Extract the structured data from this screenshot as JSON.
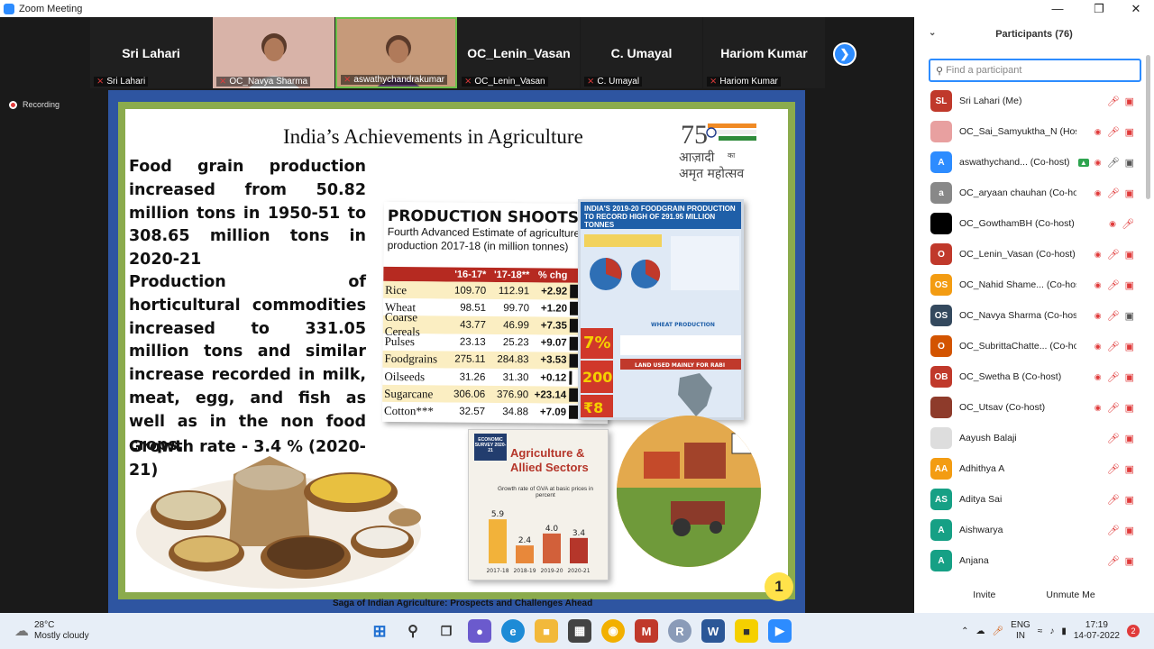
{
  "window": {
    "title": "Zoom Meeting"
  },
  "thumbnails": [
    {
      "big_name": "Sri Lahari",
      "small_name": "Sri Lahari",
      "video": false
    },
    {
      "big_name": "",
      "small_name": "OC_Navya Sharma",
      "video": true
    },
    {
      "big_name": "",
      "small_name": "aswathychandrakumar",
      "video": true,
      "active": true
    },
    {
      "big_name": "OC_Lenin_Vasan",
      "small_name": "OC_Lenin_Vasan",
      "video": false
    },
    {
      "big_name": "C. Umayal",
      "small_name": "C. Umayal",
      "video": false
    },
    {
      "big_name": "Hariom Kumar",
      "small_name": "Hariom Kumar",
      "video": false
    }
  ],
  "recording_label": "Recording",
  "slide": {
    "title": "India’s Achievements in Agriculture",
    "para1": "Food grain production increased from 50.82 million tons in 1950-51 to 308.65 million tons in 2020-21",
    "para2": "Production of horticultural commodities increased to 331.05 million tons and similar increase recorded in milk, meat, egg, and fish as well as in the non food crops.",
    "para3": "Growth rate - 3.4 % (2020-21)",
    "footer": "Saga of Indian Agriculture: Prospects and Challenges Ahead",
    "page_number": "1",
    "logo_text_1": "आज़ादी",
    "logo_text_small": "का",
    "logo_text_2": "अमृत महोत्सव",
    "logo_num": "75",
    "table": {
      "heading": "PRODUCTION SHOOTS UP",
      "subheading": "Fourth Advanced Estimate of agriculture production 2017-18 (in million tonnes)",
      "columns": [
        "",
        "'16-17*",
        "'17-18**",
        "% chg"
      ],
      "rows": [
        {
          "crop": "Rice",
          "a": "109.70",
          "b": "112.91",
          "chg": "+2.92",
          "bar": 0.9
        },
        {
          "crop": "Wheat",
          "a": "98.51",
          "b": "99.70",
          "chg": "+1.20",
          "bar": 0.55
        },
        {
          "crop": "Coarse Cereals",
          "a": "43.77",
          "b": "46.99",
          "chg": "+7.35",
          "bar": 1.0
        },
        {
          "crop": "Pulses",
          "a": "23.13",
          "b": "25.23",
          "chg": "+9.07",
          "bar": 1.0
        },
        {
          "crop": "Foodgrains",
          "a": "275.11",
          "b": "284.83",
          "chg": "+3.53",
          "bar": 0.95
        },
        {
          "crop": "Oilseeds",
          "a": "31.26",
          "b": "31.30",
          "chg": "+0.12",
          "bar": 0.1
        },
        {
          "crop": "Sugarcane",
          "a": "306.06",
          "b": "376.90",
          "chg": "+23.14",
          "bar": 1.0
        },
        {
          "crop": "Cotton***",
          "a": "32.57",
          "b": "34.88",
          "chg": "+7.09",
          "bar": 1.0
        }
      ]
    },
    "info_right_header": "INDIA'S 2019-20 FOODGRAIN PRODUCTION TO RECORD HIGH OF 291.95 MILLION TONNES",
    "info_right_sub": "WHEAT PRODUCTION",
    "info_right_sub2": "LAND USED MAINLY FOR RABI",
    "info_right_big": [
      "7%",
      "200",
      "₹8"
    ],
    "econ_survey": {
      "badge": "ECONOMIC SURVEY 2020-21",
      "title": "Agriculture & Allied Sectors",
      "subtitle": "Growth rate of GVA at basic prices in percent",
      "chart_data": {
        "type": "bar",
        "categories": [
          "2017-18",
          "2018-19",
          "2019-20",
          "2020-21"
        ],
        "values": [
          5.9,
          2.4,
          4.0,
          3.4
        ],
        "colors": [
          "#f2b23a",
          "#e8883a",
          "#d2603a",
          "#b5362a"
        ]
      }
    }
  },
  "sidebar": {
    "title": "Participants (76)",
    "search_placeholder": "Find a participant",
    "participants": [
      {
        "initials": "SL",
        "name": "Sri Lahari (Me)",
        "color": "#c0392b",
        "icons": [
          "mic-off",
          "video-off"
        ]
      },
      {
        "initials": "",
        "name": "OC_Sai_Samyuktha_N (Host)",
        "color": "#e8a0a0",
        "icons": [
          "rec",
          "mic-off",
          "video-off"
        ]
      },
      {
        "initials": "A",
        "name": "aswathychand... (Co-host)",
        "color": "#2d8cff",
        "icons": [
          "share",
          "rec",
          "mic-on",
          "video-on"
        ]
      },
      {
        "initials": "a",
        "name": "OC_aryaan chauhan (Co-host)",
        "color": "#888888",
        "icons": [
          "rec",
          "mic-off",
          "video-off"
        ]
      },
      {
        "initials": "",
        "name": "OC_GowthamBH (Co-host)",
        "color": "#000000",
        "icons": [
          "rec",
          "mic-off"
        ]
      },
      {
        "initials": "O",
        "name": "OC_Lenin_Vasan (Co-host)",
        "color": "#c0392b",
        "icons": [
          "rec",
          "mic-off",
          "video-off"
        ]
      },
      {
        "initials": "OS",
        "name": "OC_Nahid Shame... (Co-host)",
        "color": "#f39c12",
        "icons": [
          "rec",
          "mic-off",
          "video-off"
        ]
      },
      {
        "initials": "OS",
        "name": "OC_Navya Sharma (Co-host)",
        "color": "#34495e",
        "icons": [
          "rec",
          "mic-off",
          "video-on"
        ]
      },
      {
        "initials": "O",
        "name": "OC_SubrittaChatte... (Co-host)",
        "color": "#d35400",
        "icons": [
          "rec",
          "mic-off",
          "video-off"
        ]
      },
      {
        "initials": "OB",
        "name": "OC_Swetha B (Co-host)",
        "color": "#c0392b",
        "icons": [
          "rec",
          "mic-off",
          "video-off"
        ]
      },
      {
        "initials": "",
        "name": "OC_Utsav (Co-host)",
        "color": "#8e3b2b",
        "icons": [
          "rec",
          "mic-off",
          "video-off"
        ]
      },
      {
        "initials": "",
        "name": "Aayush Balaji",
        "color": "#dddddd",
        "icons": [
          "mic-off",
          "video-off"
        ]
      },
      {
        "initials": "AA",
        "name": "Adhithya A",
        "color": "#f39c12",
        "icons": [
          "mic-off",
          "video-off"
        ]
      },
      {
        "initials": "AS",
        "name": "Aditya Sai",
        "color": "#16a085",
        "icons": [
          "mic-off",
          "video-off"
        ]
      },
      {
        "initials": "A",
        "name": "Aishwarya",
        "color": "#16a085",
        "icons": [
          "mic-off",
          "video-off"
        ]
      },
      {
        "initials": "A",
        "name": "Anjana",
        "color": "#16a085",
        "icons": [
          "mic-off",
          "video-off"
        ]
      }
    ],
    "invite_label": "Invite",
    "unmute_label": "Unmute Me"
  },
  "taskbar": {
    "temperature": "28°C",
    "weather": "Mostly cloudy",
    "lang_1": "ENG",
    "lang_2": "IN",
    "time": "17:19",
    "date": "14-07-2022",
    "notifications": "2"
  }
}
